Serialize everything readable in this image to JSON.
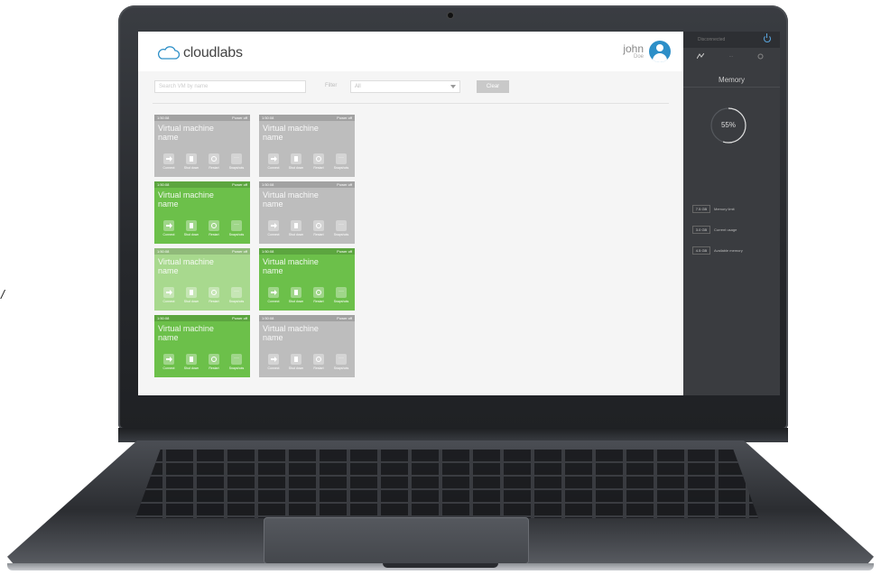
{
  "app": {
    "logo_text": "cloudlabs"
  },
  "user": {
    "first_name": "john",
    "last_name": "Doe"
  },
  "toolbar": {
    "search_placeholder": "Search VM by name",
    "filter_label": "Filter",
    "filter_value": "All",
    "clear_label": "Clear"
  },
  "vm_cards": [
    {
      "time": "1:50:08",
      "state": "Power off",
      "title": "Virtual machine name",
      "variant": "gray"
    },
    {
      "time": "1:50:08",
      "state": "Power off",
      "title": "Virtual machine name",
      "variant": "gray"
    },
    {
      "time": "1:50:08",
      "state": "Power off",
      "title": "Virtual machine name",
      "variant": "green"
    },
    {
      "time": "1:50:08",
      "state": "Power off",
      "title": "Virtual machine name",
      "variant": "gray"
    },
    {
      "time": "1:50:08",
      "state": "Power off",
      "title": "Virtual machine name",
      "variant": "light"
    },
    {
      "time": "1:50:08",
      "state": "Power off",
      "title": "Virtual machine name",
      "variant": "green"
    },
    {
      "time": "1:50:08",
      "state": "Power off",
      "title": "Virtual machine name",
      "variant": "green"
    },
    {
      "time": "1:50:08",
      "state": "Power off",
      "title": "Virtual machine name",
      "variant": "gray"
    }
  ],
  "vm_actions": [
    {
      "label": "Connect",
      "icon": "arrow-right-icon"
    },
    {
      "label": "Shut down",
      "icon": "stop-icon"
    },
    {
      "label": "Restart",
      "icon": "restart-icon"
    },
    {
      "label": "Snapshots",
      "icon": "more-icon"
    }
  ],
  "panel": {
    "status_text": "Disconnected",
    "tabs": [
      "",
      "...",
      ""
    ],
    "title": "Memory",
    "usage_percent": 55,
    "usage_text": "55%",
    "stats": [
      {
        "value": "7.5 GB",
        "label": "Memory limit"
      },
      {
        "value": "3.0 GB",
        "label": "Current usage"
      },
      {
        "value": "4.5 GB",
        "label": "Available memory"
      }
    ]
  },
  "colors": {
    "green": "#6cc04a",
    "light_green": "#a8d98e",
    "gray": "#bdbdbd",
    "panel": "#3a3c40",
    "accent": "#2d8fc8"
  },
  "side_glyph": "/"
}
